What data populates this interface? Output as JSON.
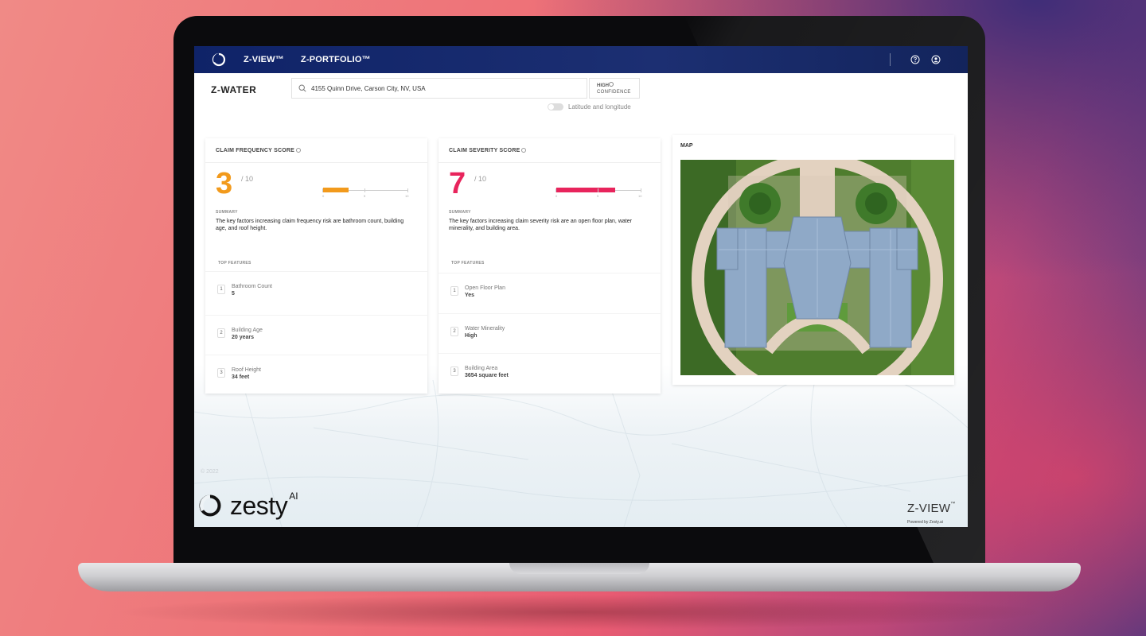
{
  "topbar": {
    "nav": [
      "Z-VIEW™",
      "Z-PORTFOLIO™"
    ],
    "help_icon": "help-icon",
    "user_icon": "user-icon"
  },
  "header": {
    "app_title": "Z-WATER",
    "search_value": "4155 Quinn Drive, Carson City, NV, USA",
    "confidence_line1": "HIGH",
    "confidence_line2": "CONFIDENCE",
    "toggle_label": "Latitude and longitude"
  },
  "frequency": {
    "title": "CLAIM FREQUENCY SCORE",
    "score": "3",
    "denominator": "/ 10",
    "score_fraction": 0.3,
    "color": "#f29a1c",
    "tick_labels": [
      "0",
      "5",
      "10"
    ],
    "summary_heading": "SUMMARY",
    "summary": "The key factors increasing claim frequency risk are bathroom count, building age, and roof height.",
    "features_heading": "TOP FEATURES",
    "features": [
      {
        "num": "1",
        "name": "Bathroom Count",
        "value": "5"
      },
      {
        "num": "2",
        "name": "Building Age",
        "value": "20 years"
      },
      {
        "num": "3",
        "name": "Roof Height",
        "value": "34 feet"
      }
    ]
  },
  "severity": {
    "title": "CLAIM SEVERITY SCORE",
    "score": "7",
    "denominator": "/ 10",
    "score_fraction": 0.7,
    "color": "#e8245c",
    "tick_labels": [
      "0",
      "5",
      "10"
    ],
    "summary_heading": "SUMMARY",
    "summary": "The key factors increasing claim severity risk are an open floor plan, water minerality, and building area.",
    "features_heading": "TOP FEATURES",
    "features": [
      {
        "num": "1",
        "name": "Open Floor Plan",
        "value": "Yes"
      },
      {
        "num": "2",
        "name": "Water Minerality",
        "value": "High"
      },
      {
        "num": "3",
        "name": "Building Area",
        "value": "3654 square feet"
      }
    ]
  },
  "map": {
    "title": "MAP"
  },
  "footer": {
    "year": "© 2022",
    "brand": "zesty",
    "brand_sup": "AI",
    "product": "Z-VIEW",
    "product_tm": "™",
    "powered": "Powered by Zesty.ai"
  }
}
